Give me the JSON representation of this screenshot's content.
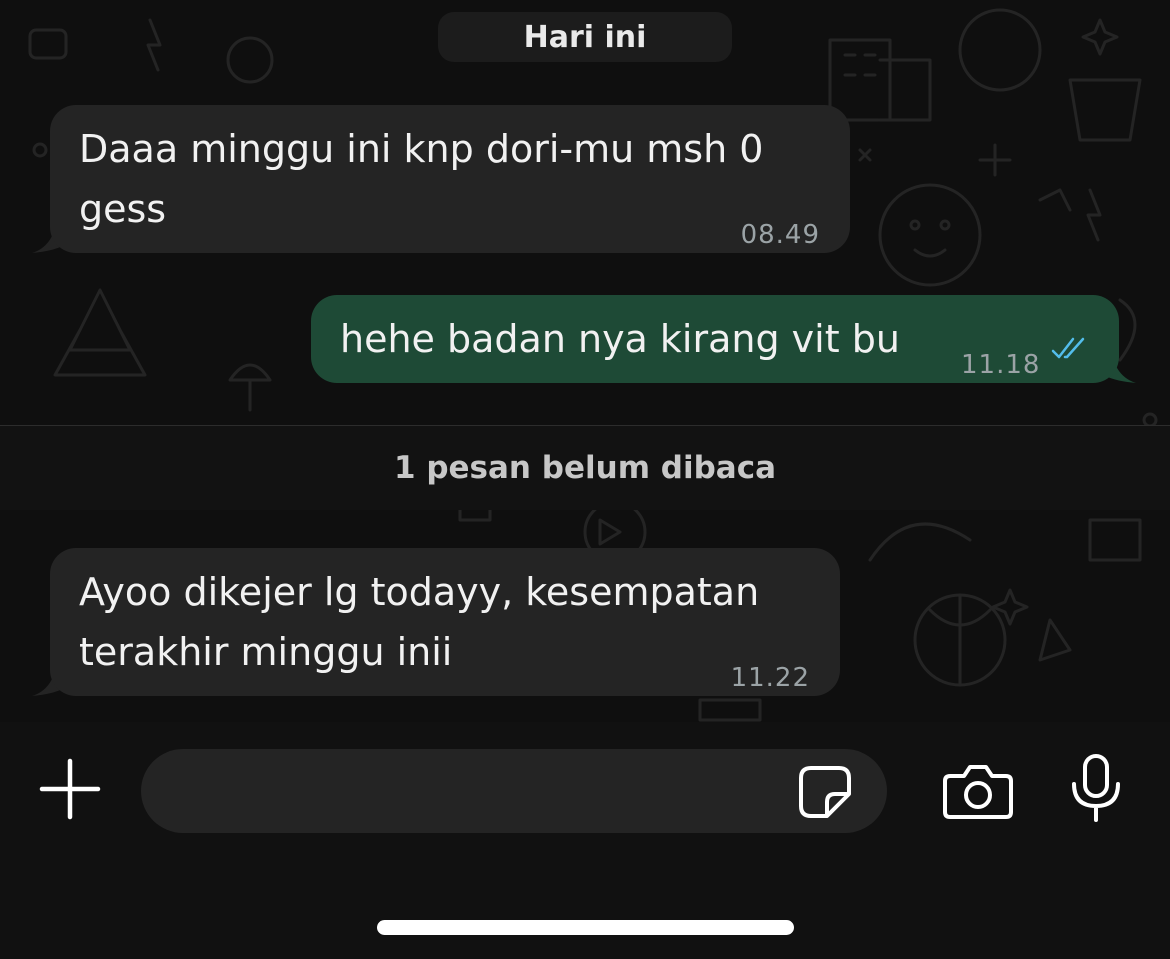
{
  "chat": {
    "date_label": "Hari ini",
    "unread_label": "1 pesan belum dibaca",
    "messages": [
      {
        "direction": "incoming",
        "text": "Daaa minggu ini knp dori-mu msh 0\ngess",
        "time": "08.49"
      },
      {
        "direction": "outgoing",
        "text": "hehe badan nya kirang vit bu",
        "time": "11.18",
        "status": "read"
      },
      {
        "direction": "incoming",
        "text": "Ayoo dikejer lg todayy, kesempatan\nterakhir minggu inii",
        "time": "11.22"
      }
    ]
  },
  "composer": {
    "input_value": "",
    "icons": [
      "plus-icon",
      "sticker-icon",
      "camera-icon",
      "microphone-icon"
    ]
  },
  "colors": {
    "incoming_bubble": "#242424",
    "outgoing_bubble": "#1e4a36",
    "read_ticks": "#53bdeb",
    "background": "#0f0f0f"
  }
}
